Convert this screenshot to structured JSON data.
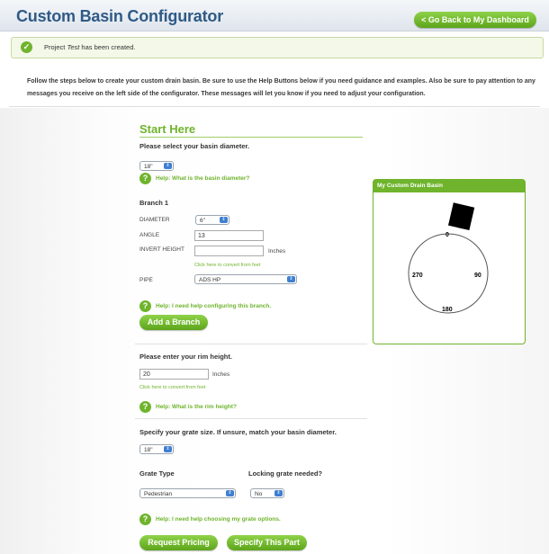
{
  "header": {
    "title": "Custom Basin Configurator",
    "dashboard_button": "< Go Back to My Dashboard"
  },
  "notice": {
    "text_before": "Project ",
    "project_name": "Test",
    "text_after": " has been created."
  },
  "intro": "Follow the steps below to create your custom drain basin. Be sure to use the Help Buttons below if you need guidance and examples. Also be sure to pay attention to any messages you receive on the left side of the configurator. These messages will let you know if you need to adjust your configuration.",
  "form": {
    "start_heading": "Start Here",
    "diameter_prompt": "Please select your basin diameter.",
    "diameter_value": "18\"",
    "help_diameter": "Help: What is the basin diameter?",
    "branch_title": "Branch 1",
    "branch_diameter_label": "DIAMETER",
    "branch_diameter_value": "6\"",
    "angle_label": "ANGLE",
    "angle_value": "13",
    "invert_label": "INVERT HEIGHT",
    "invert_value": "",
    "invert_unit": "Inches",
    "convert_link": "Click here to convert from feet",
    "pipe_label": "PIPE",
    "pipe_value": "ADS HP",
    "help_branch": "Help: I need help configuring this branch.",
    "add_branch": "Add a Branch",
    "rim_prompt": "Please enter your rim height.",
    "rim_value": "20",
    "rim_unit": "Inches",
    "rim_convert_link": "Click here to convert from feet",
    "help_rim": "Help: What is the rim height?",
    "grate_prompt": "Specify your grate size. If unsure, match your basin diameter.",
    "grate_size_value": "18\"",
    "grate_type_label": "Grate Type",
    "grate_type_value": "Pedestrian",
    "locking_label": "Locking grate needed?",
    "locking_value": "No",
    "help_grate": "Help: I need help choosing my grate options.",
    "request_pricing": "Request Pricing",
    "specify_part": "Specify This Part"
  },
  "basin": {
    "title": "My Custom Drain Basin",
    "deg0": "0",
    "deg90": "90",
    "deg180": "180",
    "deg270": "270",
    "branch_angle": 13
  },
  "colors": {
    "accent": "#6fb42c",
    "title": "#2f5a86"
  }
}
